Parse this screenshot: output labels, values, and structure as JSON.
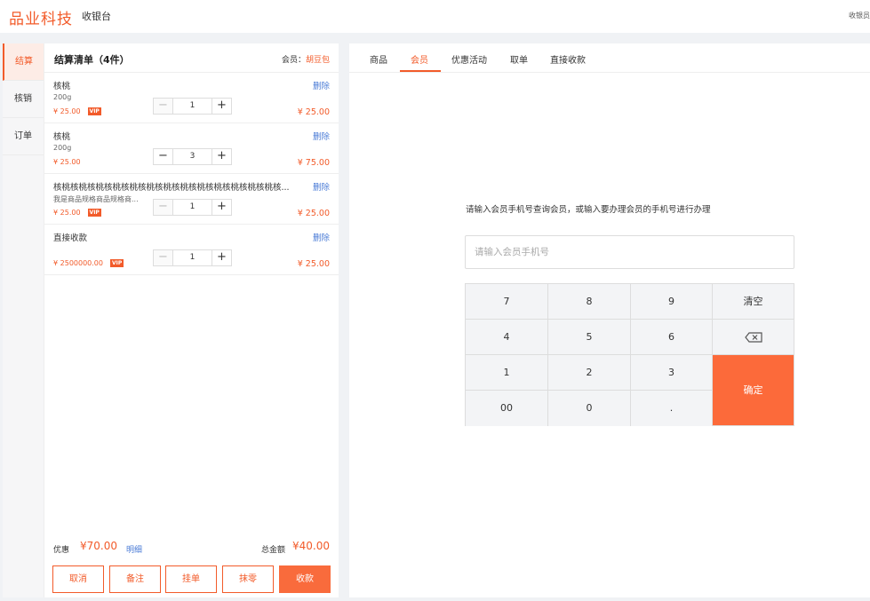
{
  "header": {
    "brand": "品业科技",
    "nav_title": "收银台",
    "cashier": "收银员"
  },
  "side_tabs": [
    "结算",
    "核销",
    "订单"
  ],
  "cart": {
    "title": "结算清单（4件）",
    "member_label": "会员：",
    "member_name": "胡豆包",
    "delete_label": "删除",
    "vip_label": "VIP",
    "items": [
      {
        "name": "核桃",
        "spec": "200g",
        "price": "¥ 25.00",
        "vip": true,
        "qty": "1",
        "minus_disabled": true,
        "subtotal": "¥ 25.00"
      },
      {
        "name": "核桃",
        "spec": "200g",
        "price": "¥ 25.00",
        "vip": false,
        "qty": "3",
        "minus_disabled": false,
        "subtotal": "¥ 75.00"
      },
      {
        "name": "核桃核桃核桃核桃核桃核桃核桃核桃核桃核桃核桃核桃核桃核...",
        "spec": "我是商品规格商品规格商...",
        "price": "¥ 25.00",
        "vip": true,
        "qty": "1",
        "minus_disabled": true,
        "subtotal": "¥ 25.00"
      },
      {
        "name": "直接收款",
        "spec": "",
        "price": "¥ 2500000.00",
        "vip": true,
        "qty": "1",
        "minus_disabled": true,
        "subtotal": "¥ 25.00"
      }
    ]
  },
  "footer": {
    "discount_label": "优惠",
    "discount_value": "¥70.00",
    "detail_link": "明细",
    "total_label": "总金额",
    "total_value": "¥40.00",
    "actions": [
      "取消",
      "备注",
      "挂单",
      "抹零",
      "收款"
    ]
  },
  "right": {
    "tabs": [
      "商品",
      "会员",
      "优惠活动",
      "取单",
      "直接收款"
    ],
    "active_tab": "会员",
    "hint": "请输入会员手机号查询会员，或输入要办理会员的手机号进行办理",
    "phone_placeholder": "请输入会员手机号",
    "keys": {
      "k7": "7",
      "k8": "8",
      "k9": "9",
      "clear": "清空",
      "k4": "4",
      "k5": "5",
      "k6": "6",
      "k1": "1",
      "k2": "2",
      "k3": "3",
      "confirm": "确定",
      "k00": "00",
      "k0": "0",
      "dot": "."
    },
    "backspace_icon": "backspace-icon"
  },
  "colors": {
    "accent": "#f25b2a",
    "confirm": "#fc6a3a",
    "link": "#4a7bd6"
  }
}
